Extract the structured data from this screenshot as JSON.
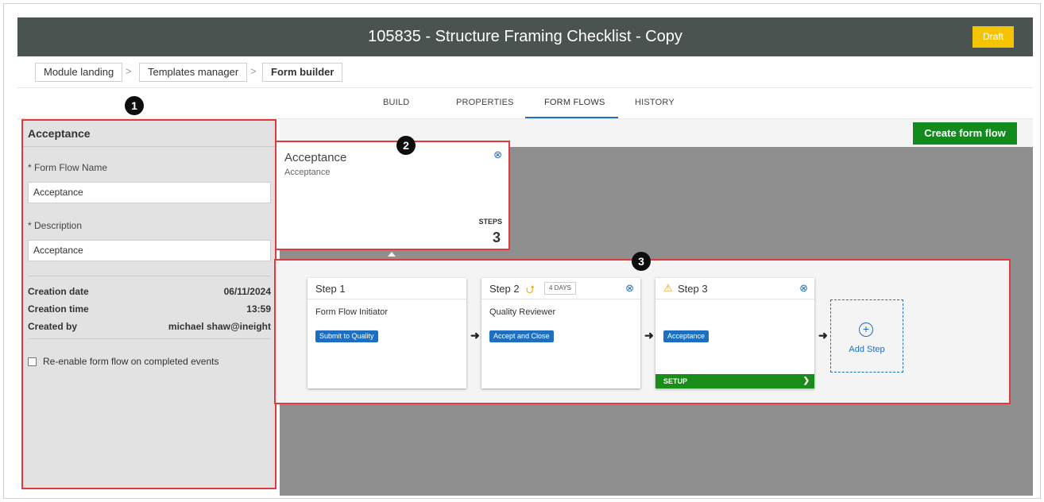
{
  "header": {
    "title": "105835 - Structure Framing Checklist - Copy",
    "status": "Draft"
  },
  "breadcrumb": [
    "Module landing",
    "Templates manager",
    "Form builder"
  ],
  "breadcrumb_separator": ">",
  "tabs": [
    "BUILD",
    "PROPERTIES",
    "FORM FLOWS",
    "HISTORY"
  ],
  "active_tab": "FORM FLOWS",
  "left_panel": {
    "title": "Acceptance",
    "name_label": "* Form Flow Name",
    "name_value": "Acceptance",
    "description_label": "* Description",
    "description_value": "Acceptance",
    "meta": [
      {
        "label": "Creation date",
        "value": "06/11/2024"
      },
      {
        "label": "Creation time",
        "value": "13:59"
      },
      {
        "label": "Created by",
        "value": "michael shaw@ineight"
      }
    ],
    "reenable_label": "Re-enable form flow on completed events",
    "reenable_checked": false
  },
  "toolbar": {
    "create_label": "Create form flow"
  },
  "flow_card": {
    "title": "Acceptance",
    "subtitle": "Acceptance",
    "steps_label": "STEPS",
    "steps_count": "3"
  },
  "steps": [
    {
      "title": "Step 1",
      "role": "Form Flow Initiator",
      "action": "Submit to Quality"
    },
    {
      "title": "Step 2",
      "role": "Quality Reviewer",
      "action": "Accept and Close",
      "badge": "4 DAYS"
    },
    {
      "title": "Step 3",
      "role": "",
      "action": "Acceptance",
      "setup_label": "SETUP"
    }
  ],
  "add_step_label": "Add Step",
  "callouts": [
    "1",
    "2",
    "3"
  ],
  "colors": {
    "header_bg": "#4a5350",
    "draft": "#f5c400",
    "primary": "#1f6fc0",
    "success": "#138a1e",
    "highlight": "#e0393e",
    "warning": "#f0a000"
  },
  "icons": {
    "close": "close-circle-icon",
    "return": "return-arrow-icon",
    "warning": "warning-icon",
    "add": "add-circle-icon",
    "arrow": "arrow-right-icon",
    "chevron": "chevron-right-icon"
  }
}
